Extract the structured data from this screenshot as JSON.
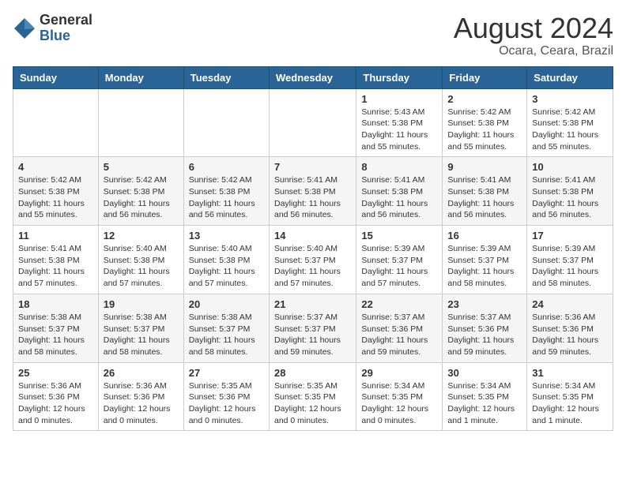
{
  "logo": {
    "general": "General",
    "blue": "Blue"
  },
  "title": {
    "month_year": "August 2024",
    "location": "Ocara, Ceara, Brazil"
  },
  "weekdays": [
    "Sunday",
    "Monday",
    "Tuesday",
    "Wednesday",
    "Thursday",
    "Friday",
    "Saturday"
  ],
  "weeks": [
    [
      {
        "day": "",
        "detail": ""
      },
      {
        "day": "",
        "detail": ""
      },
      {
        "day": "",
        "detail": ""
      },
      {
        "day": "",
        "detail": ""
      },
      {
        "day": "1",
        "detail": "Sunrise: 5:43 AM\nSunset: 5:38 PM\nDaylight: 11 hours\nand 55 minutes."
      },
      {
        "day": "2",
        "detail": "Sunrise: 5:42 AM\nSunset: 5:38 PM\nDaylight: 11 hours\nand 55 minutes."
      },
      {
        "day": "3",
        "detail": "Sunrise: 5:42 AM\nSunset: 5:38 PM\nDaylight: 11 hours\nand 55 minutes."
      }
    ],
    [
      {
        "day": "4",
        "detail": "Sunrise: 5:42 AM\nSunset: 5:38 PM\nDaylight: 11 hours\nand 55 minutes."
      },
      {
        "day": "5",
        "detail": "Sunrise: 5:42 AM\nSunset: 5:38 PM\nDaylight: 11 hours\nand 56 minutes."
      },
      {
        "day": "6",
        "detail": "Sunrise: 5:42 AM\nSunset: 5:38 PM\nDaylight: 11 hours\nand 56 minutes."
      },
      {
        "day": "7",
        "detail": "Sunrise: 5:41 AM\nSunset: 5:38 PM\nDaylight: 11 hours\nand 56 minutes."
      },
      {
        "day": "8",
        "detail": "Sunrise: 5:41 AM\nSunset: 5:38 PM\nDaylight: 11 hours\nand 56 minutes."
      },
      {
        "day": "9",
        "detail": "Sunrise: 5:41 AM\nSunset: 5:38 PM\nDaylight: 11 hours\nand 56 minutes."
      },
      {
        "day": "10",
        "detail": "Sunrise: 5:41 AM\nSunset: 5:38 PM\nDaylight: 11 hours\nand 56 minutes."
      }
    ],
    [
      {
        "day": "11",
        "detail": "Sunrise: 5:41 AM\nSunset: 5:38 PM\nDaylight: 11 hours\nand 57 minutes."
      },
      {
        "day": "12",
        "detail": "Sunrise: 5:40 AM\nSunset: 5:38 PM\nDaylight: 11 hours\nand 57 minutes."
      },
      {
        "day": "13",
        "detail": "Sunrise: 5:40 AM\nSunset: 5:38 PM\nDaylight: 11 hours\nand 57 minutes."
      },
      {
        "day": "14",
        "detail": "Sunrise: 5:40 AM\nSunset: 5:37 PM\nDaylight: 11 hours\nand 57 minutes."
      },
      {
        "day": "15",
        "detail": "Sunrise: 5:39 AM\nSunset: 5:37 PM\nDaylight: 11 hours\nand 57 minutes."
      },
      {
        "day": "16",
        "detail": "Sunrise: 5:39 AM\nSunset: 5:37 PM\nDaylight: 11 hours\nand 58 minutes."
      },
      {
        "day": "17",
        "detail": "Sunrise: 5:39 AM\nSunset: 5:37 PM\nDaylight: 11 hours\nand 58 minutes."
      }
    ],
    [
      {
        "day": "18",
        "detail": "Sunrise: 5:38 AM\nSunset: 5:37 PM\nDaylight: 11 hours\nand 58 minutes."
      },
      {
        "day": "19",
        "detail": "Sunrise: 5:38 AM\nSunset: 5:37 PM\nDaylight: 11 hours\nand 58 minutes."
      },
      {
        "day": "20",
        "detail": "Sunrise: 5:38 AM\nSunset: 5:37 PM\nDaylight: 11 hours\nand 58 minutes."
      },
      {
        "day": "21",
        "detail": "Sunrise: 5:37 AM\nSunset: 5:37 PM\nDaylight: 11 hours\nand 59 minutes."
      },
      {
        "day": "22",
        "detail": "Sunrise: 5:37 AM\nSunset: 5:36 PM\nDaylight: 11 hours\nand 59 minutes."
      },
      {
        "day": "23",
        "detail": "Sunrise: 5:37 AM\nSunset: 5:36 PM\nDaylight: 11 hours\nand 59 minutes."
      },
      {
        "day": "24",
        "detail": "Sunrise: 5:36 AM\nSunset: 5:36 PM\nDaylight: 11 hours\nand 59 minutes."
      }
    ],
    [
      {
        "day": "25",
        "detail": "Sunrise: 5:36 AM\nSunset: 5:36 PM\nDaylight: 12 hours\nand 0 minutes."
      },
      {
        "day": "26",
        "detail": "Sunrise: 5:36 AM\nSunset: 5:36 PM\nDaylight: 12 hours\nand 0 minutes."
      },
      {
        "day": "27",
        "detail": "Sunrise: 5:35 AM\nSunset: 5:36 PM\nDaylight: 12 hours\nand 0 minutes."
      },
      {
        "day": "28",
        "detail": "Sunrise: 5:35 AM\nSunset: 5:35 PM\nDaylight: 12 hours\nand 0 minutes."
      },
      {
        "day": "29",
        "detail": "Sunrise: 5:34 AM\nSunset: 5:35 PM\nDaylight: 12 hours\nand 0 minutes."
      },
      {
        "day": "30",
        "detail": "Sunrise: 5:34 AM\nSunset: 5:35 PM\nDaylight: 12 hours\nand 1 minute."
      },
      {
        "day": "31",
        "detail": "Sunrise: 5:34 AM\nSunset: 5:35 PM\nDaylight: 12 hours\nand 1 minute."
      }
    ]
  ]
}
